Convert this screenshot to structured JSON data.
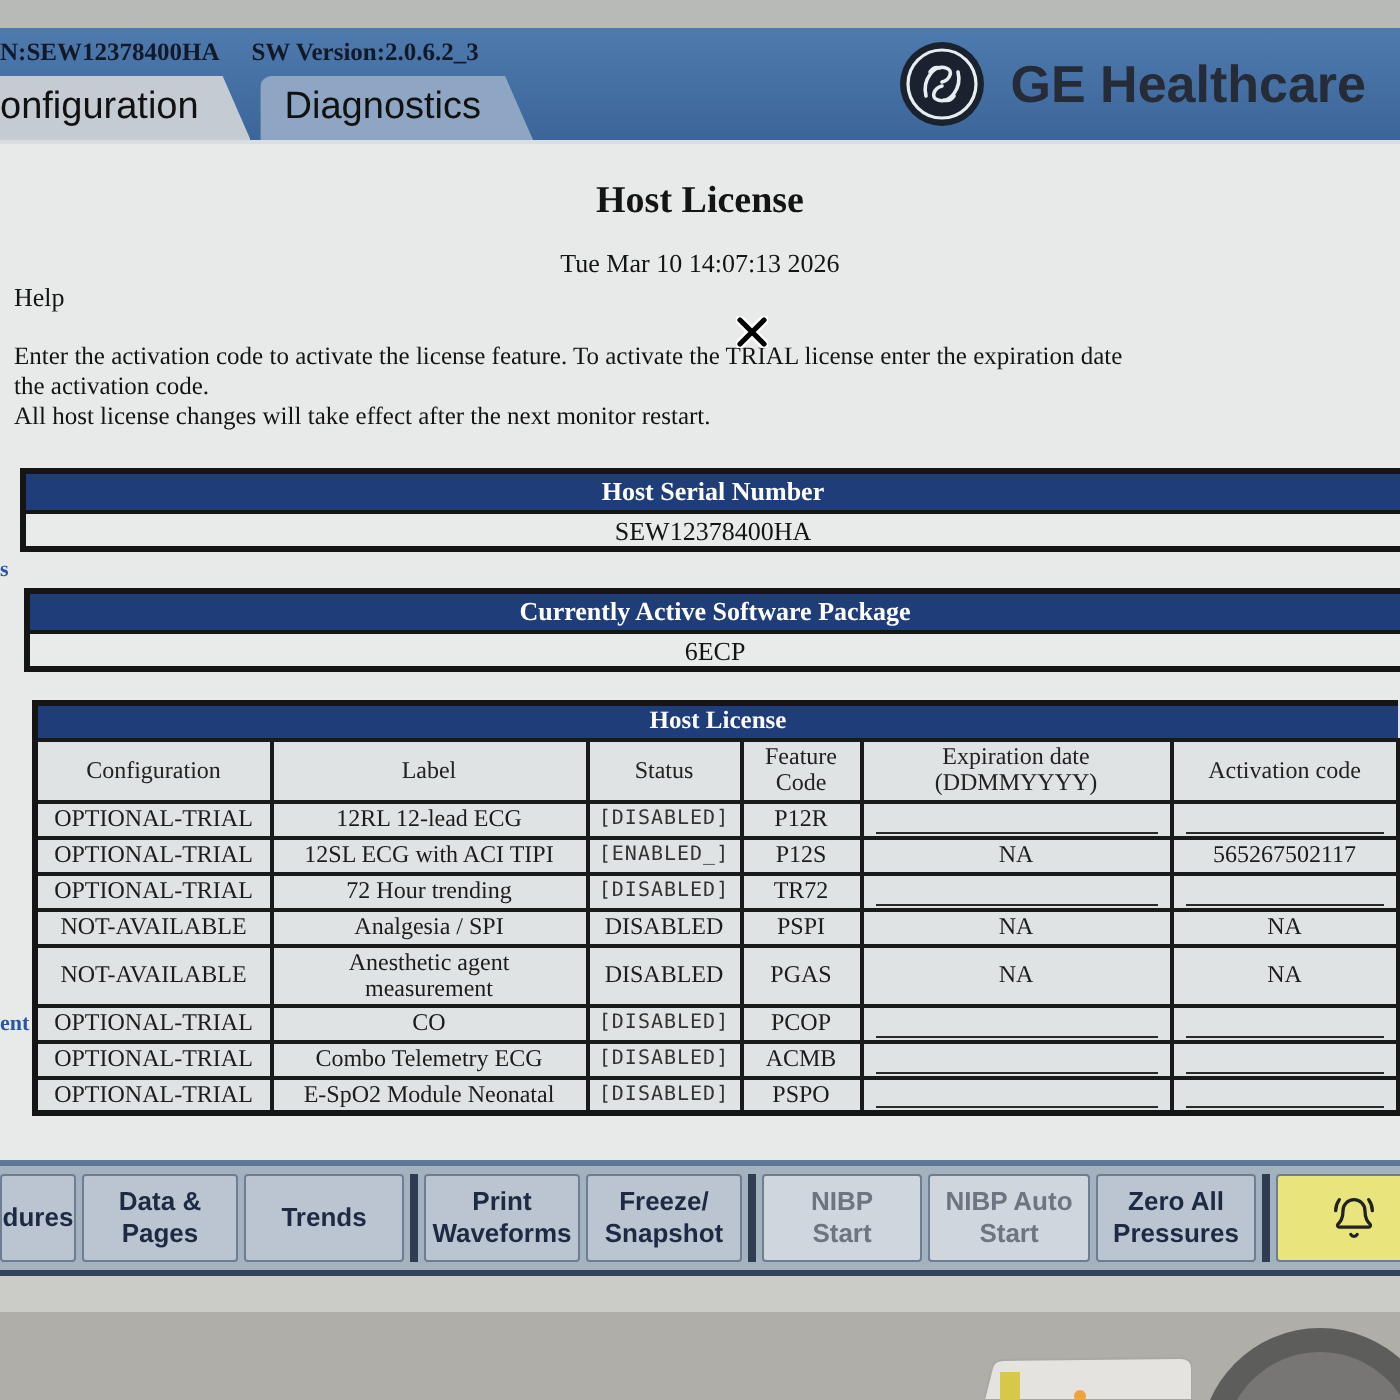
{
  "header": {
    "serial": "N:SEW12378400HA",
    "version": "SW Version:2.0.6.2_3",
    "tabs": [
      {
        "label": "onfiguration",
        "selected": true
      },
      {
        "label": "Diagnostics",
        "selected": false
      }
    ],
    "brand": "GE Healthcare"
  },
  "page": {
    "title": "Host License",
    "timestamp": "Tue Mar 10 14:07:13 2026",
    "help_label": "Help",
    "help_lines": [
      "Enter the activation code to activate the license feature. To activate the TRIAL license enter the expiration date",
      "the activation code.",
      "All host license changes will take effect after the next monitor restart."
    ]
  },
  "side_fragments": [
    {
      "text": "s"
    },
    {
      "text": "ent"
    }
  ],
  "serial_panel": {
    "heading": "Host Serial Number",
    "value": "SEW12378400HA"
  },
  "package_panel": {
    "heading": "Currently Active Software Package",
    "value": "6ECP"
  },
  "license_table": {
    "heading": "Host License",
    "columns": [
      "Configuration",
      "Label",
      "Status",
      "Feature Code",
      "Expiration date (DDMMYYYY)",
      "Activation code"
    ],
    "rows": [
      {
        "kind": "trial",
        "configuration": "OPTIONAL-TRIAL",
        "label": "12RL 12-lead ECG",
        "status": "[DISABLED]",
        "feature_code": "P12R",
        "expiration": {
          "kind": "blank"
        },
        "activation_code": {
          "kind": "blank"
        }
      },
      {
        "kind": "trial",
        "configuration": "OPTIONAL-TRIAL",
        "label": "12SL ECG with ACI TIPI",
        "status": "[ENABLED_]",
        "feature_code": "P12S",
        "expiration": {
          "kind": "text",
          "value": "NA"
        },
        "activation_code": {
          "kind": "text",
          "value": "565267502117"
        }
      },
      {
        "kind": "trial",
        "configuration": "OPTIONAL-TRIAL",
        "label": "72 Hour trending",
        "status": "[DISABLED]",
        "feature_code": "TR72",
        "expiration": {
          "kind": "blank"
        },
        "activation_code": {
          "kind": "blank"
        }
      },
      {
        "kind": "fixed",
        "configuration": "NOT-AVAILABLE",
        "label": "Analgesia / SPI",
        "status": "DISABLED",
        "feature_code": "PSPI",
        "expiration": {
          "kind": "text",
          "value": "NA"
        },
        "activation_code": {
          "kind": "text",
          "value": "NA"
        }
      },
      {
        "kind": "fixed",
        "configuration": "NOT-AVAILABLE",
        "label": "Anesthetic agent\nmeasurement",
        "status": "DISABLED",
        "feature_code": "PGAS",
        "expiration": {
          "kind": "text",
          "value": "NA"
        },
        "activation_code": {
          "kind": "text",
          "value": "NA"
        }
      },
      {
        "kind": "trial",
        "configuration": "OPTIONAL-TRIAL",
        "label": "CO",
        "status": "[DISABLED]",
        "feature_code": "PCOP",
        "expiration": {
          "kind": "blank"
        },
        "activation_code": {
          "kind": "blank"
        }
      },
      {
        "kind": "trial",
        "configuration": "OPTIONAL-TRIAL",
        "label": "Combo Telemetry ECG",
        "status": "[DISABLED]",
        "feature_code": "ACMB",
        "expiration": {
          "kind": "blank"
        },
        "activation_code": {
          "kind": "blank"
        }
      },
      {
        "kind": "trial",
        "configuration": "OPTIONAL-TRIAL",
        "label": "E-SpO2 Module Neonatal",
        "status": "[DISABLED]",
        "feature_code": "PSPO",
        "expiration": {
          "kind": "blank"
        },
        "activation_code": {
          "kind": "blank"
        }
      }
    ]
  },
  "button_groups": [
    {
      "buttons": [
        {
          "kind": "text",
          "label": "dures",
          "disabled": false
        },
        {
          "kind": "text",
          "label": "Data &\nPages",
          "disabled": false
        },
        {
          "kind": "text",
          "label": "Trends",
          "disabled": false
        }
      ]
    },
    {
      "buttons": [
        {
          "kind": "text",
          "label": "Print\nWaveforms",
          "disabled": false
        },
        {
          "kind": "text",
          "label": "Freeze/\nSnapshot",
          "disabled": false
        }
      ]
    },
    {
      "buttons": [
        {
          "kind": "text",
          "label": "NIBP\nStart",
          "disabled": true
        },
        {
          "kind": "text",
          "label": "NIBP Auto\nStart",
          "disabled": true
        },
        {
          "kind": "text",
          "label": "Zero All\nPressures",
          "disabled": false
        }
      ]
    },
    {
      "buttons": [
        {
          "kind": "alarm",
          "disabled": false
        }
      ]
    }
  ]
}
